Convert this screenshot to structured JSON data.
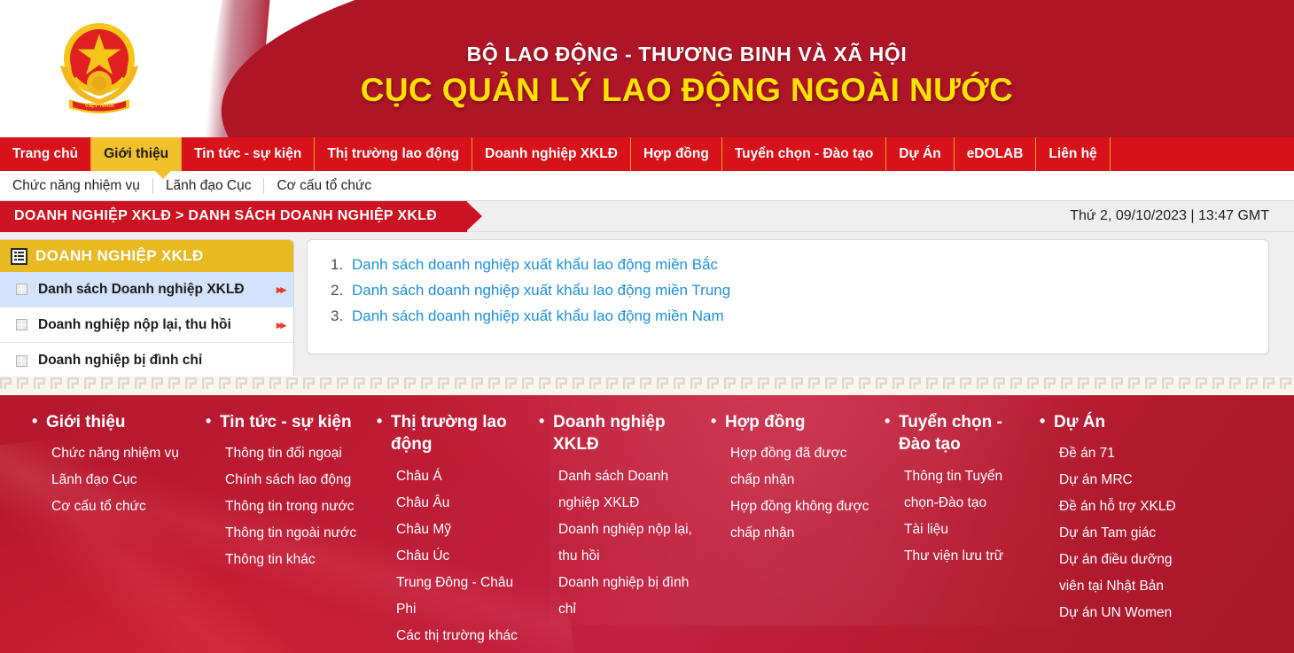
{
  "header": {
    "ministry": "BỘ LAO ĐỘNG - THƯƠNG BINH VÀ XÃ HỘI",
    "department": "CỤC QUẢN LÝ LAO ĐỘNG NGOÀI NƯỚC",
    "emblem_alt": "vietnam-emblem",
    "colors": {
      "red": "#ae1627",
      "yellow": "#ffe100",
      "nav_red": "#d7121a",
      "nav_active": "#f0c12b"
    }
  },
  "nav": {
    "items": [
      {
        "label": "Trang chủ",
        "active": false
      },
      {
        "label": "Giới thiệu",
        "active": true
      },
      {
        "label": "Tin tức - sự kiện",
        "active": false
      },
      {
        "label": "Thị trường lao động",
        "active": false
      },
      {
        "label": "Doanh nghiệp XKLĐ",
        "active": false
      },
      {
        "label": "Hợp đồng",
        "active": false
      },
      {
        "label": "Tuyển chọn - Đào tạo",
        "active": false
      },
      {
        "label": "Dự Án",
        "active": false
      },
      {
        "label": "eDOLAB",
        "active": false
      },
      {
        "label": "Liên hệ",
        "active": false
      }
    ]
  },
  "subnav": {
    "items": [
      {
        "label": "Chức năng nhiệm vụ"
      },
      {
        "label": "Lãnh đạo Cục"
      },
      {
        "label": "Cơ cấu tổ chức"
      }
    ]
  },
  "breadcrumb": {
    "text": "DOANH NGHIỆP XKLĐ > DANH SÁCH DOANH NGHIỆP XKLĐ",
    "datetime": "Thứ 2, 09/10/2023 | 13:47 GMT"
  },
  "sidebar": {
    "title": "DOANH NGHIỆP XKLĐ",
    "icon": "list-icon",
    "items": [
      {
        "label": "Danh sách Doanh nghiệp XKLĐ",
        "selected": true,
        "has_arrow": true
      },
      {
        "label": "Doanh nghiệp nộp lại, thu hồi",
        "selected": false,
        "has_arrow": true
      },
      {
        "label": "Doanh nghiệp bị đình chỉ",
        "selected": false,
        "has_arrow": false
      }
    ]
  },
  "main": {
    "links": [
      {
        "num": "1.",
        "label": "Danh sách doanh nghiệp xuất khẩu lao động miền Bắc"
      },
      {
        "num": "2.",
        "label": "Danh sách doanh nghiệp xuất khẩu lao động miền Trung"
      },
      {
        "num": "3.",
        "label": "Danh sách doanh nghiệp xuất khẩu lao động miền Nam"
      }
    ]
  },
  "footer": {
    "columns": [
      {
        "title": "Giới thiệu",
        "links": [
          "Chức năng nhiệm vụ",
          "Lãnh đạo Cục",
          "Cơ cấu tổ chức"
        ]
      },
      {
        "title": "Tin tức - sự kiện",
        "links": [
          "Thông tin đối ngoại",
          "Chính sách lao động",
          "Thông tin trong nước",
          "Thông tin ngoài nước",
          "Thông tin khác"
        ]
      },
      {
        "title": "Thị trường lao động",
        "links": [
          "Châu Á",
          "Châu Âu",
          "Châu Mỹ",
          "Châu Úc",
          "Trung Đông - Châu Phi",
          "Các thị trường khác"
        ]
      },
      {
        "title": "Doanh nghiệp XKLĐ",
        "links": [
          "Danh sách Doanh nghiệp XKLĐ",
          "Doanh nghiệp nộp lại, thu hồi",
          "Doanh nghiệp bị đình chỉ"
        ]
      },
      {
        "title": "Hợp đồng",
        "links": [
          "Hợp đồng đã được chấp nhận",
          "Hợp đồng không được chấp nhận"
        ]
      },
      {
        "title": "Tuyển chọn - Đào tạo",
        "links": [
          "Thông tin Tuyển chọn-Đào tạo",
          "Tài liệu",
          "Thư viện lưu trữ"
        ]
      },
      {
        "title": "Dự Án",
        "links": [
          "Đề án 71",
          "Dự án MRC",
          "Đề án hỗ trợ XKLĐ",
          "Dự án Tam giác",
          "Dự án điều dưỡng viên tại Nhật Bản",
          "Dự án UN Women"
        ]
      }
    ]
  }
}
